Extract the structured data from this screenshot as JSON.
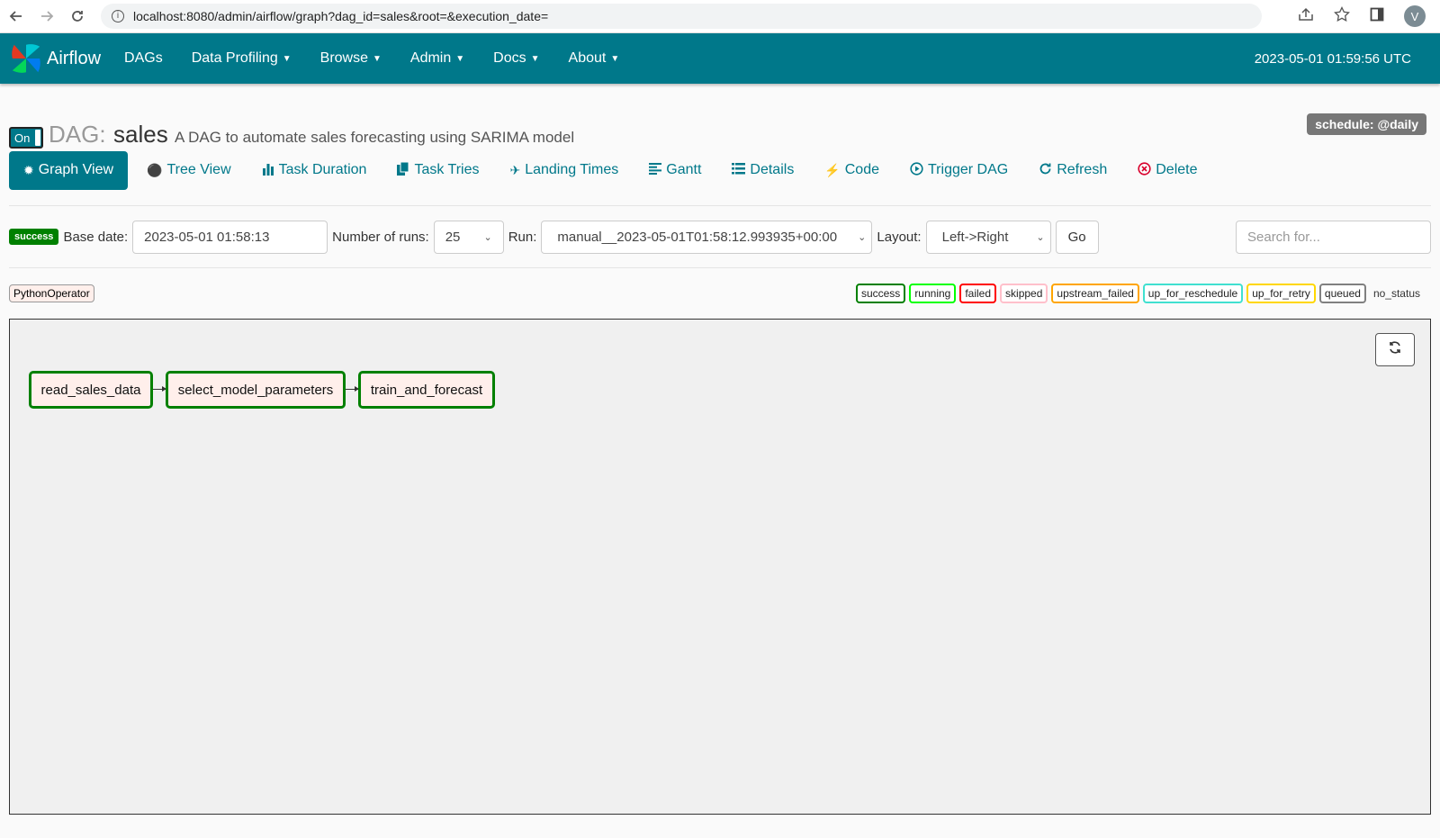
{
  "browser": {
    "url": "localhost:8080/admin/airflow/graph?dag_id=sales&root=&execution_date=",
    "profile_initial": "V"
  },
  "navbar": {
    "brand": "Airflow",
    "items": [
      {
        "label": "DAGs",
        "dropdown": false
      },
      {
        "label": "Data Profiling",
        "dropdown": true
      },
      {
        "label": "Browse",
        "dropdown": true
      },
      {
        "label": "Admin",
        "dropdown": true
      },
      {
        "label": "Docs",
        "dropdown": true
      },
      {
        "label": "About",
        "dropdown": true
      }
    ],
    "time": "2023-05-01 01:59:56 UTC",
    "color": "#00788a"
  },
  "dag": {
    "toggle": "On",
    "label": "DAG:",
    "name": "sales",
    "description": "A DAG to automate sales forecasting using SARIMA model",
    "schedule": "schedule: @daily"
  },
  "tabs": [
    {
      "label": "Graph View",
      "icon": "graph-icon"
    },
    {
      "label": "Tree View",
      "icon": "tree-icon"
    },
    {
      "label": "Task Duration",
      "icon": "bar-chart-icon"
    },
    {
      "label": "Task Tries",
      "icon": "files-icon"
    },
    {
      "label": "Landing Times",
      "icon": "plane-icon"
    },
    {
      "label": "Gantt",
      "icon": "align-left-icon"
    },
    {
      "label": "Details",
      "icon": "list-icon"
    },
    {
      "label": "Code",
      "icon": "flash-icon"
    },
    {
      "label": "Trigger DAG",
      "icon": "play-circle-icon"
    },
    {
      "label": "Refresh",
      "icon": "refresh-icon"
    },
    {
      "label": "Delete",
      "icon": "remove-circle-icon"
    }
  ],
  "form": {
    "status": "success",
    "base_date_label": "Base date:",
    "base_date": "2023-05-01 01:58:13",
    "num_runs_label": "Number of runs:",
    "num_runs": "25",
    "run_label": "Run:",
    "run": "manual__2023-05-01T01:58:12.993935+00:00",
    "layout_label": "Layout:",
    "layout": "Left->Right",
    "go": "Go",
    "search_placeholder": "Search for..."
  },
  "operator": "PythonOperator",
  "states": [
    {
      "label": "success",
      "color": "#008000"
    },
    {
      "label": "running",
      "color": "#00ff00"
    },
    {
      "label": "failed",
      "color": "#ff0000"
    },
    {
      "label": "skipped",
      "color": "#ffc0cb"
    },
    {
      "label": "upstream_failed",
      "color": "#ffa500"
    },
    {
      "label": "up_for_reschedule",
      "color": "#40e0d0"
    },
    {
      "label": "up_for_retry",
      "color": "#ffd700"
    },
    {
      "label": "queued",
      "color": "#808080"
    }
  ],
  "no_status": "no_status",
  "tasks": [
    "read_sales_data",
    "select_model_parameters",
    "train_and_forecast"
  ]
}
